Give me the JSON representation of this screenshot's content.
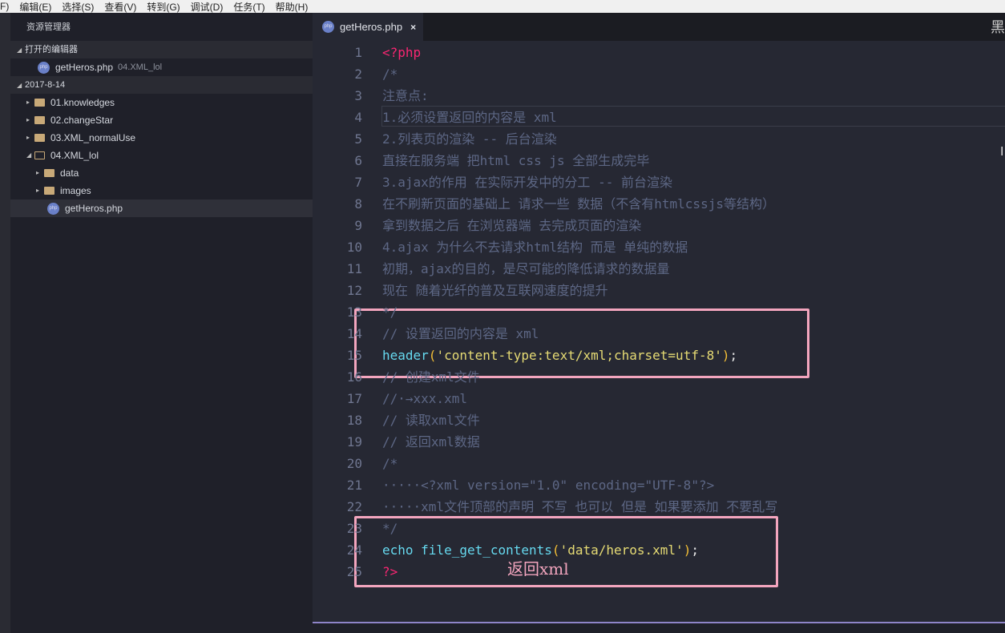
{
  "menu": [
    "F)",
    "编辑(E)",
    "选择(S)",
    "查看(V)",
    "转到(G)",
    "调试(D)",
    "任务(T)",
    "帮助(H)"
  ],
  "sidebar": {
    "title": "资源管理器",
    "open_editors_label": "打开的编辑器",
    "open_file": {
      "name": "getHeros.php",
      "folder": "04.XML_lol"
    },
    "workspace_label": "2017-8-14",
    "tree": [
      {
        "name": "01.knowledges",
        "type": "folder",
        "depth": 1,
        "open": false
      },
      {
        "name": "02.changeStar",
        "type": "folder",
        "depth": 1,
        "open": false
      },
      {
        "name": "03.XML_normalUse",
        "type": "folder",
        "depth": 1,
        "open": false
      },
      {
        "name": "04.XML_lol",
        "type": "folder",
        "depth": 1,
        "open": true
      },
      {
        "name": "data",
        "type": "folder",
        "depth": 2,
        "open": false
      },
      {
        "name": "images",
        "type": "folder",
        "depth": 2,
        "open": false
      },
      {
        "name": "getHeros.php",
        "type": "php",
        "depth": 2,
        "selected": true
      }
    ],
    "php_icon_text": "php"
  },
  "tab": {
    "label": "getHeros.php",
    "close": "×"
  },
  "corner_text": "黑",
  "code": [
    [
      [
        "kw",
        "<?php"
      ]
    ],
    [
      [
        "cm",
        "/*"
      ]
    ],
    [
      [
        "cm",
        "注意点:"
      ]
    ],
    [
      [
        "cm",
        "1.必须设置返回的内容是 xml"
      ]
    ],
    [
      [
        "cm",
        "2.列表页的渲染 -- 后台渲染"
      ]
    ],
    [
      [
        "cm",
        "直接在服务端 把html css js 全部生成完毕"
      ]
    ],
    [
      [
        "cm",
        "3.ajax的作用 在实际开发中的分工 -- 前台渲染"
      ]
    ],
    [
      [
        "cm",
        "在不刷新页面的基础上 请求一些 数据（不含有htmlcssjs等结构）"
      ]
    ],
    [
      [
        "cm",
        "拿到数据之后 在浏览器端 去完成页面的渲染"
      ]
    ],
    [
      [
        "cm",
        "4.ajax 为什么不去请求html结构 而是 单纯的数据"
      ]
    ],
    [
      [
        "cm",
        "初期，ajax的目的，是尽可能的降低请求的数据量"
      ]
    ],
    [
      [
        "cm",
        "现在 随着光纤的普及互联网速度的提升"
      ]
    ],
    [
      [
        "cm",
        "*/"
      ]
    ],
    [
      [
        "cm",
        "// 设置返回的内容是 xml"
      ]
    ],
    [
      [
        "fn",
        "header"
      ],
      [
        "par",
        "("
      ],
      [
        "str",
        "'content-type:text/xml;charset=utf-8'"
      ],
      [
        "par",
        ")"
      ],
      [
        "pun",
        ";"
      ]
    ],
    [
      [
        "cm",
        "// 创建xml文件"
      ]
    ],
    [
      [
        "cm",
        "//·→xxx.xml"
      ]
    ],
    [
      [
        "cm",
        "// 读取xml文件"
      ]
    ],
    [
      [
        "cm",
        "// 返回xml数据"
      ]
    ],
    [
      [
        "cm",
        "/*"
      ]
    ],
    [
      [
        "cm",
        "·····<?xml version=\"1.0\" encoding=\"UTF-8\"?>"
      ]
    ],
    [
      [
        "cm",
        "·····xml文件顶部的声明 不写 也可以 但是 如果要添加 不要乱写"
      ]
    ],
    [
      [
        "cm",
        "*/"
      ]
    ],
    [
      [
        "fn",
        "echo file_get_contents"
      ],
      [
        "par",
        "("
      ],
      [
        "str",
        "'data/heros.xml'"
      ],
      [
        "par",
        ")"
      ],
      [
        "pun",
        ";"
      ]
    ],
    [
      [
        "kw",
        "?>"
      ]
    ]
  ],
  "annotation": "返回xml",
  "colors": {
    "accent": "#f3a5be",
    "keyword": "#f92672",
    "function": "#66d9ef",
    "string": "#e6db74"
  }
}
